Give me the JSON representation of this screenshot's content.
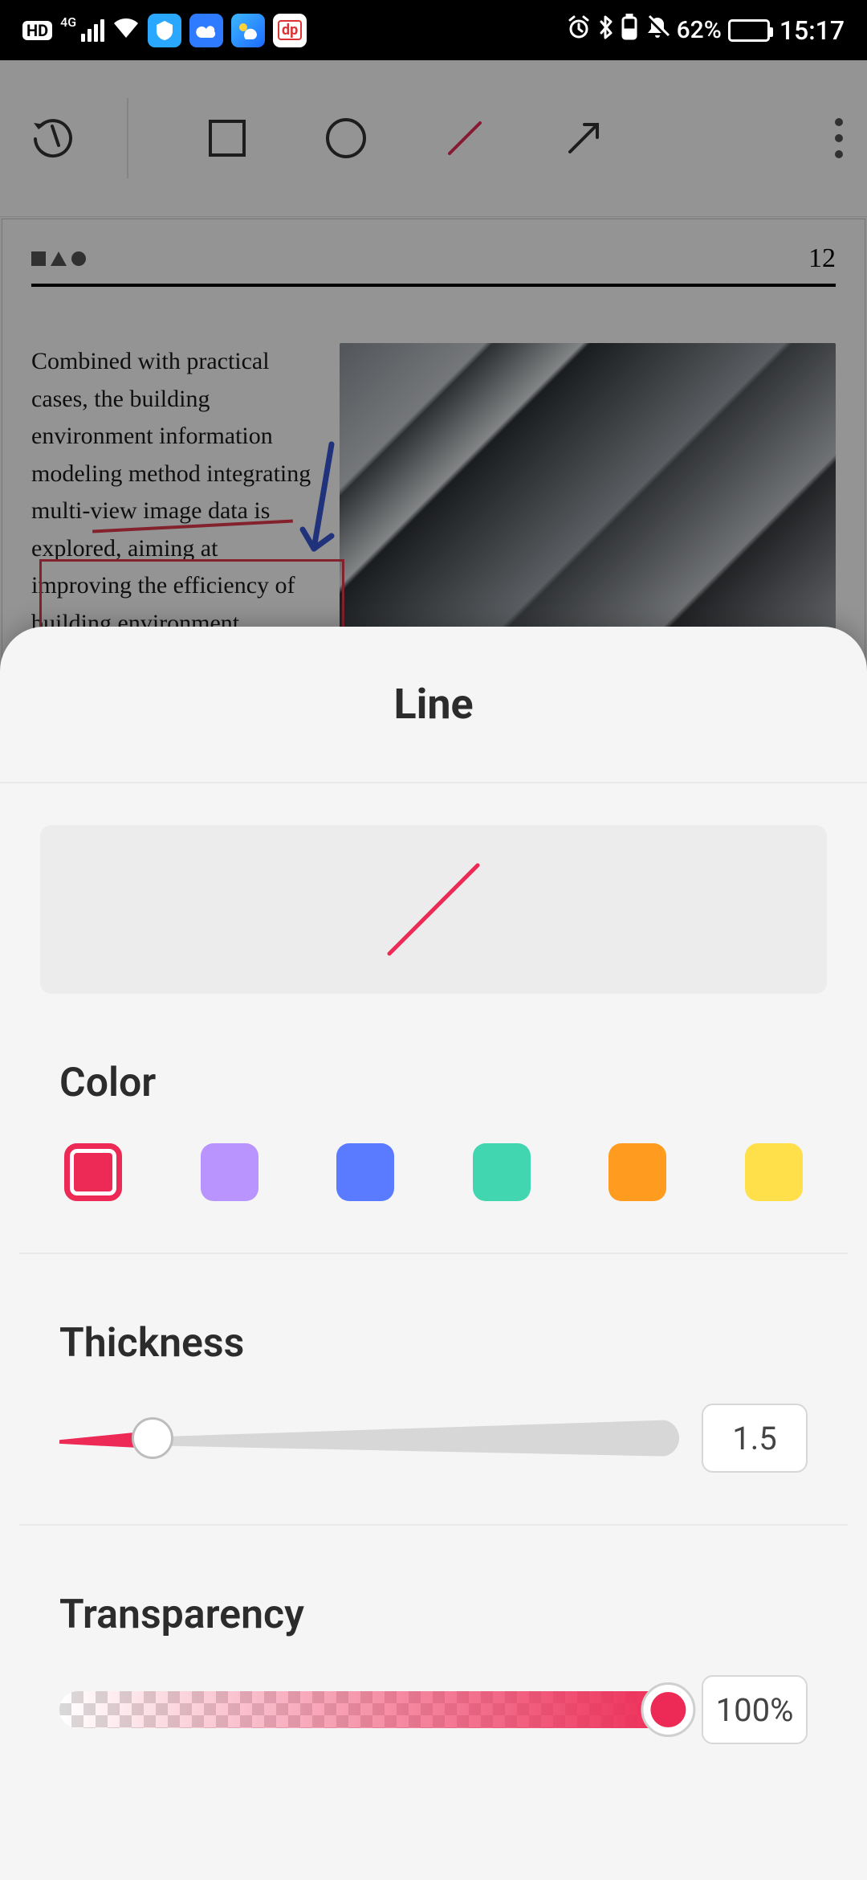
{
  "status": {
    "battery_pct": "62%",
    "time": "15:17",
    "network_label": "4G"
  },
  "document": {
    "page_number": "12",
    "paragraph": "Combined with practical cases, the building environment information modeling method integrating multi-view image data is explored, aiming at improving the efficiency of building environment information modeling and improving the modeling accuracy of"
  },
  "sheet": {
    "title": "Line",
    "sections": {
      "color": "Color",
      "thickness": "Thickness",
      "transparency": "Transparency"
    },
    "colors": {
      "selected_index": 0,
      "options": [
        "#ed2a55",
        "#b994ff",
        "#5a7bff",
        "#41d6b0",
        "#ff9b1f",
        "#ffe04a"
      ]
    },
    "thickness": {
      "value": "1.5",
      "percent": 15
    },
    "transparency": {
      "value": "100%",
      "percent": 100
    },
    "preview_color": "#ed2a55"
  }
}
